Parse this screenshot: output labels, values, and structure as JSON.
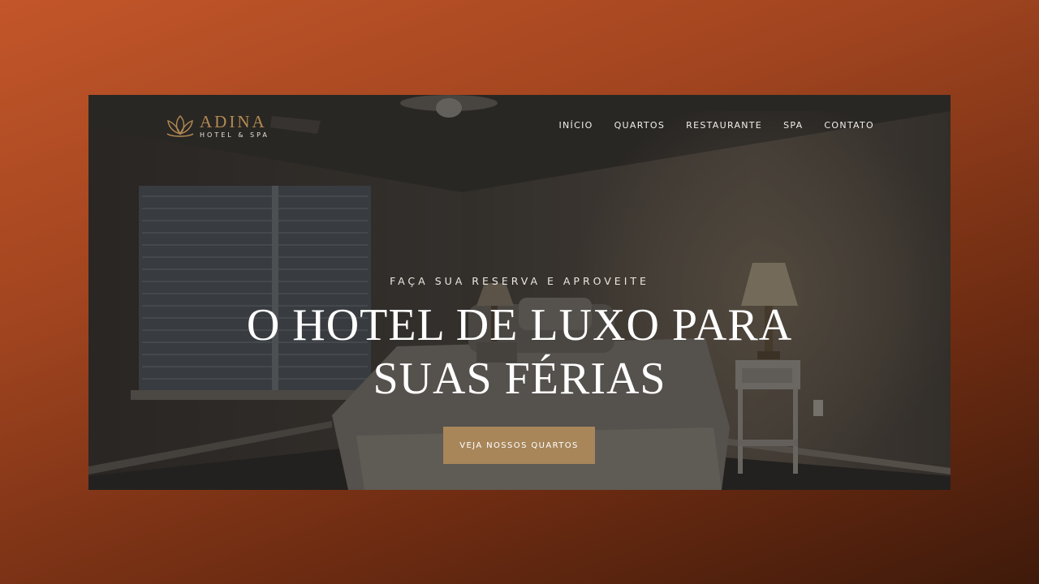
{
  "brand": {
    "name": "ADINA",
    "tagline": "HOTEL & SPA",
    "logo_icon": "lotus-icon",
    "accent_color": "#a8865a"
  },
  "nav": {
    "items": [
      {
        "label": "INÍCIO"
      },
      {
        "label": "QUARTOS"
      },
      {
        "label": "RESTAURANTE"
      },
      {
        "label": "SPA"
      },
      {
        "label": "CONTATO"
      }
    ]
  },
  "hero": {
    "eyebrow": "FAÇA SUA RESERVA E APROVEITE",
    "headline": "O HOTEL DE LUXO PARA SUAS FÉRIAS",
    "cta_label": "VEJA NOSSOS QUARTOS"
  }
}
